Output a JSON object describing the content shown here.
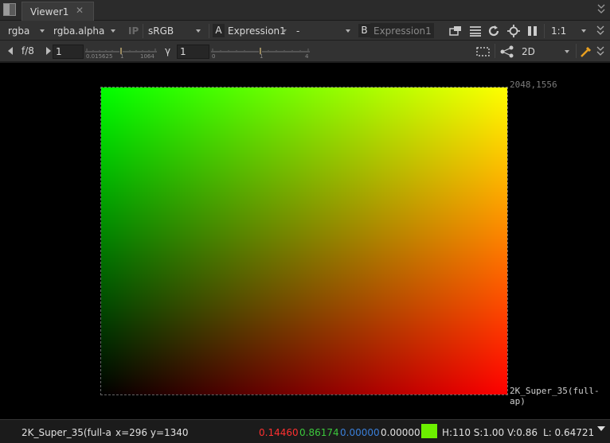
{
  "tab": {
    "title": "Viewer1",
    "close": "✕"
  },
  "toolbar1": {
    "channels": "rgba",
    "alpha_channel": "rgba.alpha",
    "ip_label": "IP",
    "colorspace": "sRGB",
    "a_label": "A",
    "a_input": "Expression1",
    "compare_mode": "-",
    "b_label": "B",
    "b_input": "Expression1",
    "zoom": "1:1"
  },
  "toolbar2": {
    "fstop": "f/8",
    "gain_value": "1",
    "gain_ticks": [
      "0.015625",
      "1",
      "1064"
    ],
    "gamma_label": "γ",
    "gamma_value": "1",
    "gamma_ticks": [
      "0",
      "1",
      "4"
    ],
    "view_mode": "2D"
  },
  "viewer": {
    "format_corner": "2048,1556",
    "format_name": "2K_Super_35(full-ap)"
  },
  "status": {
    "format": "2K_Super_35(full-a",
    "coords": "x=296 y=1340",
    "r": "0.14460",
    "g": "0.86174",
    "b": "0.00000",
    "a": "0.00000",
    "hsv": "H:110 S:1.00 V:0.86",
    "luminance": "L: 0.64721"
  },
  "colors": {
    "red": "#ff3030",
    "green": "#3cc83c",
    "blue": "#3a7fd8",
    "white": "#e0e0e0",
    "swatch": "#6cf000",
    "accent": "#e8a020"
  },
  "icons": [
    "viewer-tab-icon",
    "close-icon",
    "roi-icon",
    "wipe-icon",
    "refresh-icon",
    "settings-icon",
    "pause-icon",
    "overflow-icon",
    "region-select-icon",
    "node-graph-icon",
    "color-picker-icon"
  ]
}
